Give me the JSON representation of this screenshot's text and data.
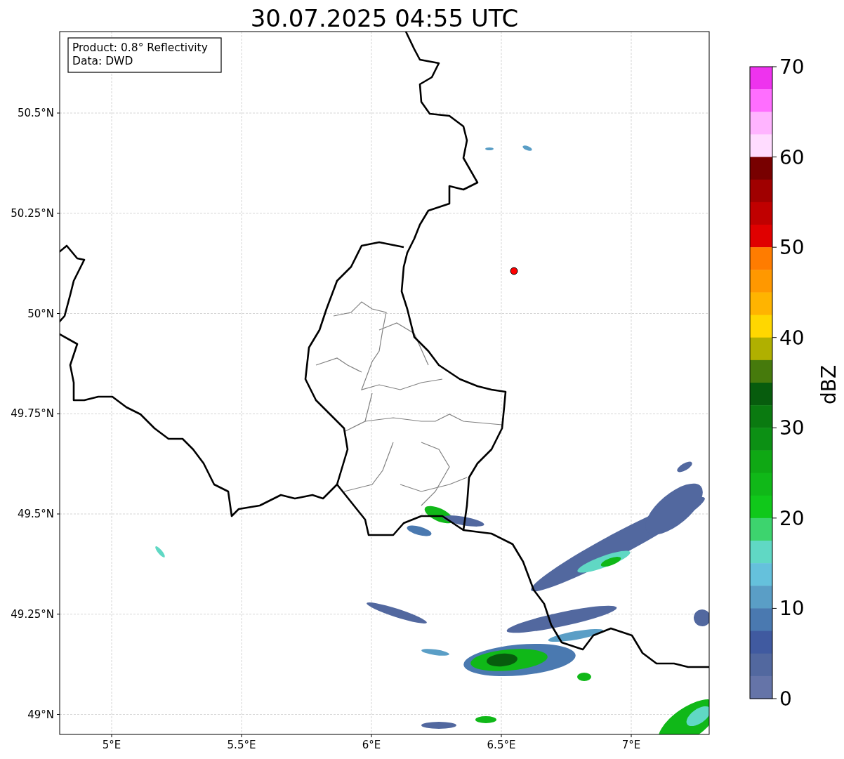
{
  "title": "30.07.2025 04:55 UTC",
  "legend": {
    "lines": [
      "Product: 0.8° Reflectivity",
      "Data: DWD"
    ]
  },
  "lat_ticks": [
    "50.5°N",
    "50.25°N",
    "50°N",
    "49.75°N",
    "49.5°N",
    "49.25°N",
    "49°N"
  ],
  "lon_ticks": [
    "5°E",
    "5.5°E",
    "6°E",
    "6.5°E",
    "7°E"
  ],
  "colorbar": {
    "label": "dBZ",
    "ticks": [
      "70",
      "60",
      "50",
      "40",
      "30",
      "20",
      "10",
      "0"
    ],
    "bands": [
      {
        "color": "#ee33ee"
      },
      {
        "color": "#ff6eff"
      },
      {
        "color": "#ffb4ff"
      },
      {
        "color": "#ffdcff"
      },
      {
        "color": "#780000"
      },
      {
        "color": "#a00000"
      },
      {
        "color": "#c00000"
      },
      {
        "color": "#e00000"
      },
      {
        "color": "#ff7c00"
      },
      {
        "color": "#ff9800"
      },
      {
        "color": "#ffb400"
      },
      {
        "color": "#ffd700"
      },
      {
        "color": "#b0b000"
      },
      {
        "color": "#467a0c"
      },
      {
        "color": "#075c0d"
      },
      {
        "color": "#0a7a10"
      },
      {
        "color": "#0c9014"
      },
      {
        "color": "#0fa814"
      },
      {
        "color": "#10b818"
      },
      {
        "color": "#10c81a"
      },
      {
        "color": "#3dd46e"
      },
      {
        "color": "#60d8c4"
      },
      {
        "color": "#65c1dc"
      },
      {
        "color": "#5a9ec6"
      },
      {
        "color": "#4a79b0"
      },
      {
        "color": "#405aa0"
      },
      {
        "color": "#52689f"
      },
      {
        "color": "#6574a8"
      }
    ]
  }
}
